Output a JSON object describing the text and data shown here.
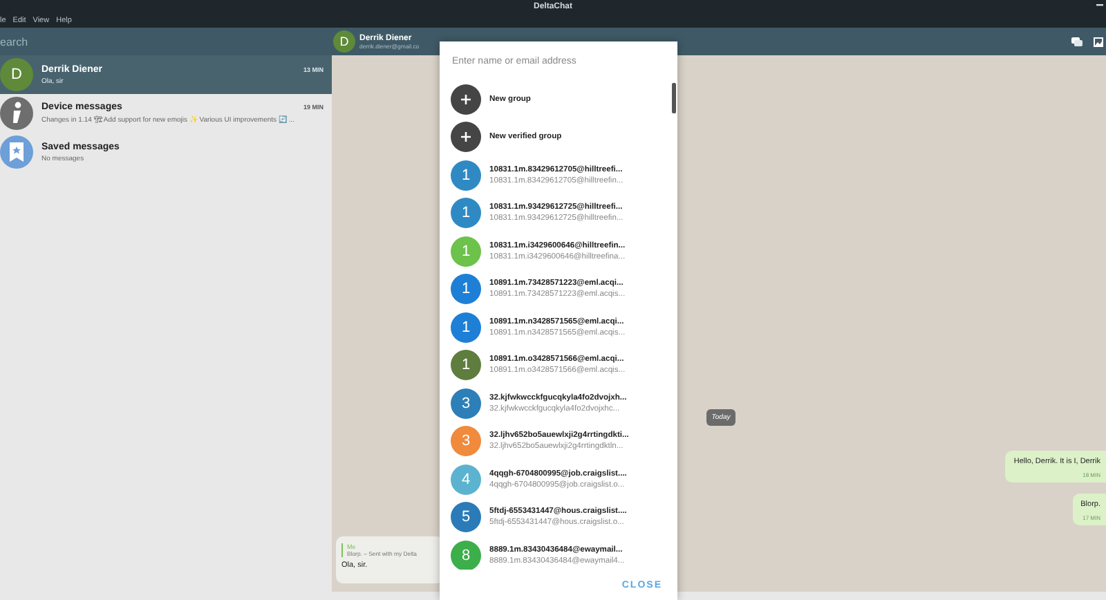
{
  "window": {
    "title": "DeltaChat"
  },
  "menu": [
    "le",
    "Edit",
    "View",
    "Help"
  ],
  "sidebar": {
    "search": {
      "placeholder": "earch"
    },
    "chats": [
      {
        "kind": "letter",
        "initial": "D",
        "name": "Derrik Diener",
        "preview": "Ola, sir",
        "time": "13 MIN",
        "selected": true
      },
      {
        "kind": "info",
        "name": "Device messages",
        "preview": "Changes in 1.14 🏗 Add support for new emojis ✨ Various UI improvements 🔄 ...",
        "time": "19 MIN",
        "selected": false
      },
      {
        "kind": "bookmark",
        "name": "Saved messages",
        "preview": "No messages",
        "selected": false
      }
    ]
  },
  "chat": {
    "contact": {
      "initial": "D",
      "name": "Derrik Diener",
      "address": "derrik.diener@gmail.co"
    },
    "day_marker": "Today",
    "messages": [
      {
        "kind": "outgoing",
        "text": "Hello, Derrik. It is I, Derrik",
        "time": "18 MIN"
      },
      {
        "kind": "outgoing",
        "text": "Blorp.",
        "time": "17 MIN"
      },
      {
        "kind": "incoming",
        "sender": "Me",
        "quote": "Blorp. – Sent with my Delta",
        "text": "Ola, sir."
      }
    ]
  },
  "dialog": {
    "search": {
      "placeholder": "Enter name or email address"
    },
    "items": [
      {
        "kind": "action",
        "label": "New group"
      },
      {
        "kind": "action",
        "label": "New verified group"
      },
      {
        "kind": "contact",
        "initial": "1",
        "color": "#2f8ac4",
        "name": "10831.1m.83429612705@hilltreefi...",
        "address": "10831.1m.83429612705@hilltreefin..."
      },
      {
        "kind": "contact",
        "initial": "1",
        "color": "#2f8ac4",
        "name": "10831.1m.93429612725@hilltreefi...",
        "address": "10831.1m.93429612725@hilltreefin..."
      },
      {
        "kind": "contact",
        "initial": "1",
        "color": "#6cc24a",
        "name": "10831.1m.i3429600646@hilltreefin...",
        "address": "10831.1m.i3429600646@hilltreefina..."
      },
      {
        "kind": "contact",
        "initial": "1",
        "color": "#1e7fd6",
        "name": "10891.1m.73428571223@eml.acqi...",
        "address": "10891.1m.73428571223@eml.acqis..."
      },
      {
        "kind": "contact",
        "initial": "1",
        "color": "#1e7fd6",
        "name": "10891.1m.n3428571565@eml.acqi...",
        "address": "10891.1m.n3428571565@eml.acqis..."
      },
      {
        "kind": "contact",
        "initial": "1",
        "color": "#5e7d3e",
        "name": "10891.1m.o3428571566@eml.acqi...",
        "address": "10891.1m.o3428571566@eml.acqis..."
      },
      {
        "kind": "contact",
        "initial": "3",
        "color": "#2d7fb8",
        "name": "32.kjfwkwcckfgucqkyla4fo2dvojxh...",
        "address": "32.kjfwkwcckfgucqkyla4fo2dvojxhc..."
      },
      {
        "kind": "contact",
        "initial": "3",
        "color": "#f08a3c",
        "name": "32.ljhv652bo5auewlxji2g4rrtingdkti...",
        "address": "32.ljhv652bo5auewlxji2g4rrtingdktln..."
      },
      {
        "kind": "contact",
        "initial": "4",
        "color": "#5bb3d0",
        "name": "4qqgh-6704800995@job.craigslist....",
        "address": "4qqgh-6704800995@job.craigslist.o..."
      },
      {
        "kind": "contact",
        "initial": "5",
        "color": "#2b7bb8",
        "name": "5ftdj-6553431447@hous.craigslist....",
        "address": "5ftdj-6553431447@hous.craigslist.o..."
      },
      {
        "kind": "contact",
        "initial": "8",
        "color": "#3cae4a",
        "name": "8889.1m.83430436484@ewaymail...",
        "address": "8889.1m.83430436484@ewaymail4..."
      }
    ],
    "close": "CLOSE"
  }
}
